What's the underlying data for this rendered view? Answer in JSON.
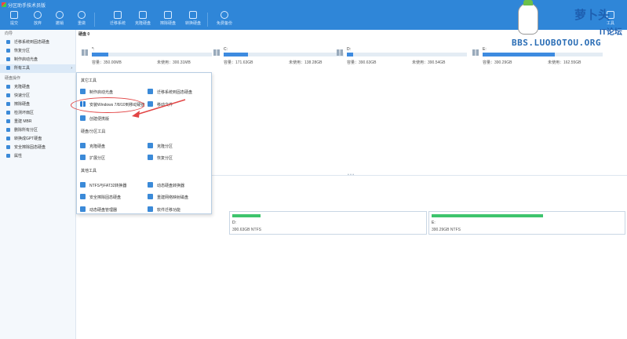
{
  "app": {
    "title": "分区助手技术员版"
  },
  "toolbar": {
    "buttons": [
      {
        "label": "提交"
      },
      {
        "label": "放弃"
      },
      {
        "label": "撤销"
      },
      {
        "label": "重做"
      },
      {
        "label": "迁移系统"
      },
      {
        "label": "克隆硬盘"
      },
      {
        "label": "擦除硬盘"
      },
      {
        "label": "转换硬盘"
      },
      {
        "label": "免费备份"
      },
      {
        "label": "工具"
      }
    ]
  },
  "watermark": {
    "text": "BBS.LUOBOTOU.ORG",
    "brand": "萝卜头",
    "brand2": "IT论坛"
  },
  "sidebar": {
    "section_wizard": "向导",
    "wizard_items": [
      {
        "label": "迁移系统到固态硬盘"
      },
      {
        "label": "恢复分区"
      },
      {
        "label": "制作启动光盘"
      },
      {
        "label": "所有工具",
        "more": "›"
      }
    ],
    "section_ops": "硬盘操作",
    "op_items": [
      {
        "label": "克隆硬盘"
      },
      {
        "label": "快速分区"
      },
      {
        "label": "擦除硬盘"
      },
      {
        "label": "检测坏扇区"
      },
      {
        "label": "重建 MBR"
      },
      {
        "label": "删除所有分区"
      },
      {
        "label": "转换成GPT硬盘"
      },
      {
        "label": "安全擦除固态硬盘"
      },
      {
        "label": "属性"
      }
    ]
  },
  "main": {
    "title": "硬盘 0",
    "disks": [
      {
        "label": "*:",
        "cap": "容量：350.00MB",
        "free": "未使用：300.31MB",
        "used_fraction": 0.14
      },
      {
        "label": "C:",
        "cap": "容量：171.63GB",
        "free": "未使用：138.28GB",
        "used_fraction": 0.2
      },
      {
        "label": "D:",
        "cap": "容量：390.63GB",
        "free": "未使用：390.54GB",
        "used_fraction": 0.05
      },
      {
        "label": "E:",
        "cap": "容量：390.29GB",
        "free": "未使用：162.55GB",
        "used_fraction": 0.6
      }
    ],
    "partitions": [
      {
        "label": "D:",
        "info": "390.63GB NTFS",
        "used_fraction": 0.05
      },
      {
        "label": "E:",
        "info": "390.29GB NTFS",
        "used_fraction": 0.58
      }
    ]
  },
  "dropdown": {
    "section1": "其它工具",
    "tools1": [
      {
        "label": "制作启动光盘"
      },
      {
        "label": "迁移系统到固态硬盘"
      },
      {
        "label": "安装Windows 7/8/10到移动硬盘"
      },
      {
        "label": "移动文件"
      },
      {
        "label": "创建便携版"
      }
    ],
    "section2": "硬盘/分区工具",
    "tools2": [
      {
        "label": "克隆硬盘"
      },
      {
        "label": "克隆分区"
      },
      {
        "label": "扩展分区"
      },
      {
        "label": "恢复分区"
      }
    ],
    "section3": "其他工具",
    "tools3": [
      {
        "label": "NTFS与FAT32转换器"
      },
      {
        "label": "动态硬盘转换器"
      },
      {
        "label": "安全擦除固态硬盘"
      },
      {
        "label": "重建网络映射磁盘"
      },
      {
        "label": "动态硬盘管理器"
      },
      {
        "label": "软件迁移功能"
      }
    ]
  },
  "colors": {
    "accent": "#2f86d8",
    "highlight": "#e24545",
    "partition_green": "#3ec46d"
  }
}
